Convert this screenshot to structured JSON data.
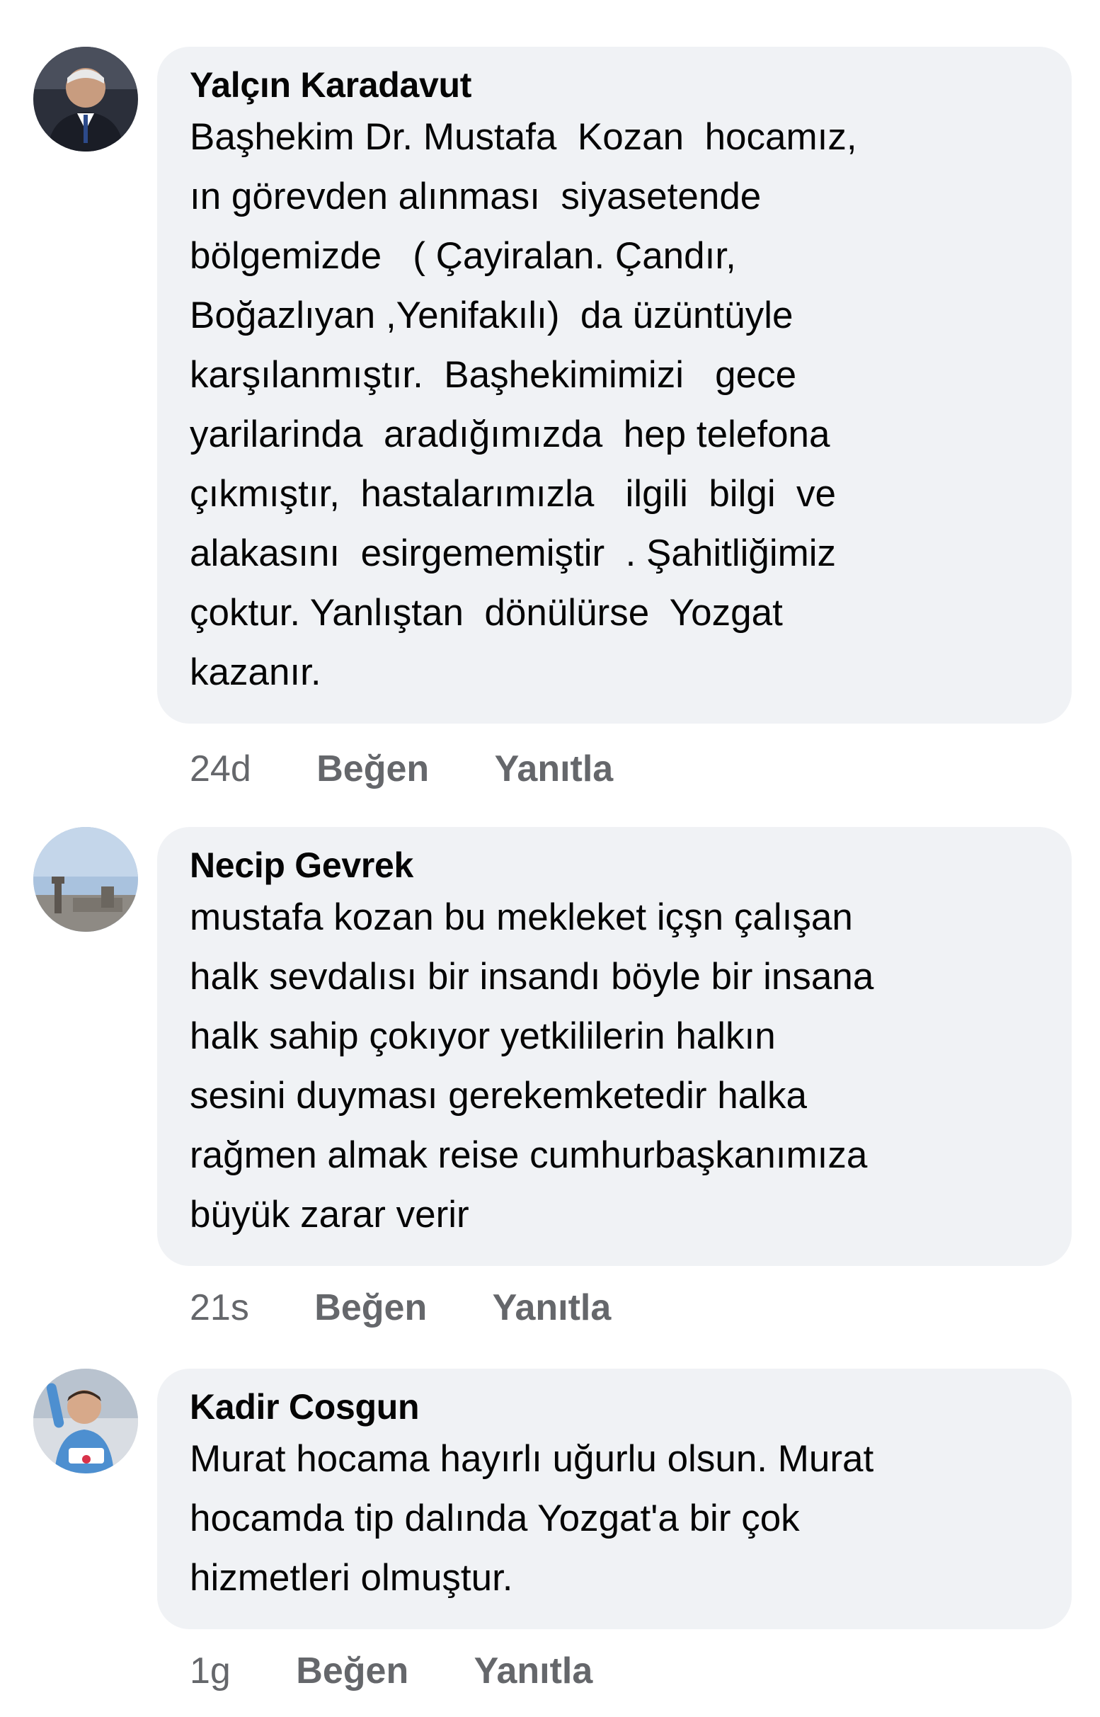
{
  "comments": [
    {
      "author": "Yalçın Karadavut",
      "text": "Başhekim Dr. Mustafa  Kozan  hocamız,\nın görevden alınması  siyasetende\nbölgemizde   ( Çayiralan. Çandır,\nBoğazlıyan ,Yenifakılı)  da üzüntüyle\nkarşılanmıştır.  Başhekimimizi   gece\nyarilarinda  aradığımızda  hep telefona\nçıkmıştır,  hastalarımızla   ilgili  bilgi  ve\nalakasını  esirgememiştir  . Şahitliğimiz\nçoktur. Yanlıştan  dönülürse  Yozgat\nkazanır.",
      "time": "24d",
      "like_label": "Beğen",
      "reply_label": "Yanıtla"
    },
    {
      "author": "Necip Gevrek",
      "text": "mustafa kozan bu mekleket içşn çalışan\nhalk sevdalısı bir insandı böyle bir insana\nhalk sahip çokıyor yetkililerin halkın\nsesini duyması gerekemketedir halka\nrağmen almak reise cumhurbaşkanımıza\nbüyük zarar verir",
      "time": "21s",
      "like_label": "Beğen",
      "reply_label": "Yanıtla"
    },
    {
      "author": "Kadir Cosgun",
      "text": "Murat hocama hayırlı uğurlu olsun. Murat\nhocamda tip dalında Yozgat'a bir çok\nhizmetleri olmuştur.",
      "time": "1g",
      "like_label": "Beğen",
      "reply_label": "Yanıtla"
    }
  ],
  "colors": {
    "bubble_bg": "#f0f2f5",
    "text": "#050505",
    "meta": "#65676b"
  }
}
